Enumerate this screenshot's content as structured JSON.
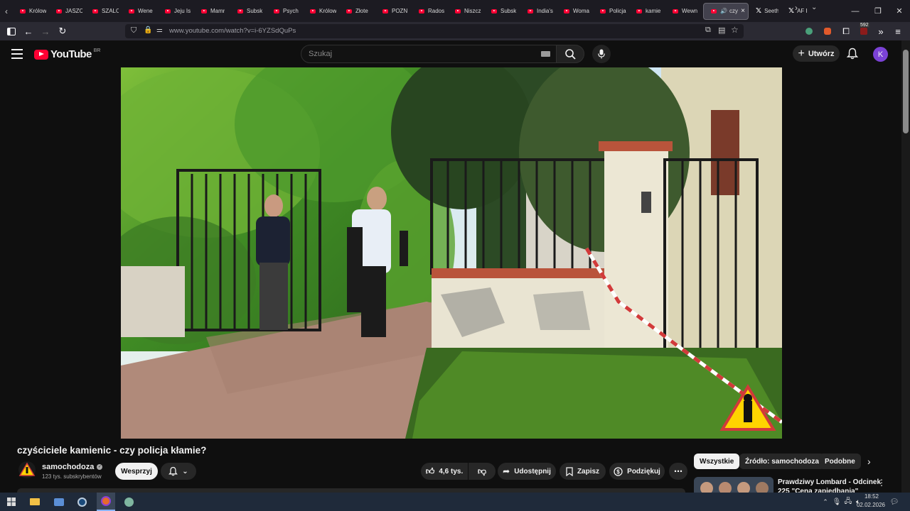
{
  "browser": {
    "tabs": [
      {
        "label": "Królow"
      },
      {
        "label": "JASZC"
      },
      {
        "label": "SZALO"
      },
      {
        "label": "Wene"
      },
      {
        "label": "Jeju Is"
      },
      {
        "label": "Mamr"
      },
      {
        "label": "Subsk"
      },
      {
        "label": "Psych"
      },
      {
        "label": "Królow"
      },
      {
        "label": "Złote"
      },
      {
        "label": "POZN"
      },
      {
        "label": "Rados"
      },
      {
        "label": "Niszcz"
      },
      {
        "label": "Subsk"
      },
      {
        "label": "India's"
      },
      {
        "label": "Woma"
      },
      {
        "label": "Policja"
      },
      {
        "label": "kamie"
      },
      {
        "label": "Wewn"
      }
    ],
    "active_tab": {
      "label": "czy"
    },
    "x_tabs": [
      {
        "label": "Seeth"
      },
      {
        "label": "AF F"
      }
    ],
    "url": "www.youtube.com/watch?v=i-6YZSdQuPs",
    "badge_count": "592"
  },
  "youtube": {
    "logo_text": "YouTube",
    "logo_region": "BR",
    "search_placeholder": "Szukaj",
    "create_label": "Utwórz",
    "avatar_letter": "K"
  },
  "video": {
    "title": "czyściciele kamienic - czy policja kłamie?",
    "channel_name": "samochodoza",
    "subscribers": "123 tys. subskrybentów",
    "support_label": "Wesprzyj",
    "likes": "4,6 tys.",
    "share_label": "Udostępnij",
    "save_label": "Zapisz",
    "thanks_label": "Podziękuj"
  },
  "recommendations": {
    "chips": [
      {
        "label": "Wszystkie"
      },
      {
        "label": "Źródło: samochodoza"
      },
      {
        "label": "Podobne"
      }
    ],
    "first_item_title_line1": "Prawdziwy Lombard - Odcinek",
    "first_item_title_line2": "225 \"Cena zapiedbania\""
  },
  "taskbar": {
    "time": "18:52",
    "date": "02.02.2026"
  },
  "colors": {
    "yt_red": "#ff0033",
    "avatar": "#7b42d6",
    "bg": "#0f0f0f"
  }
}
